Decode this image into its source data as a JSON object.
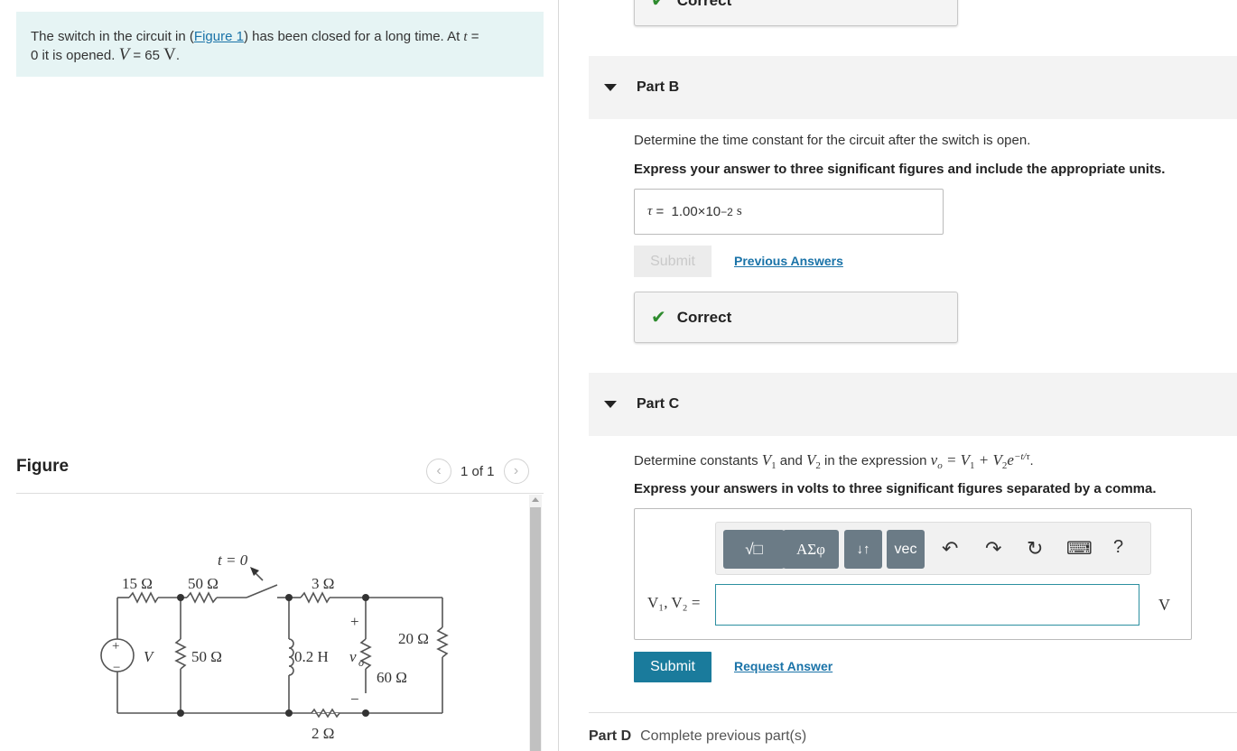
{
  "problem": {
    "text_before_link": "The switch in the circuit in (",
    "link": "Figure 1",
    "text_after_link": ") has been closed for a long time. At ",
    "t_var": "t",
    "eq_zero": " = ",
    "line2": "0 it is opened. ",
    "v_var": "V",
    "v_value": " = 65 ",
    "v_unit": "V",
    "period": "."
  },
  "figure": {
    "label": "Figure",
    "page": "1 of 1",
    "prev_icon": "chevron-left-icon",
    "next_icon": "chevron-right-icon",
    "circuit_labels": {
      "switch": "t = 0",
      "r15": "15 Ω",
      "r50a": "50 Ω",
      "r3": "3 Ω",
      "plus_top": "+",
      "r20": "20 Ω",
      "source": "V",
      "source_plus": "+",
      "source_minus": "−",
      "r50b": "50 Ω",
      "inductor": "0.2 H",
      "vo": "v",
      "vo_sub": "o",
      "r60": "60 Ω",
      "minus_bottom": "−",
      "r2": "2 Ω"
    }
  },
  "partA_feedback": {
    "label": "Correct"
  },
  "partB": {
    "title": "Part B",
    "question": "Determine the time constant for the circuit after the switch is open.",
    "instruction": "Express your answer to three significant figures and include the appropriate units.",
    "answer_var": "τ",
    "answer_eq": " = ",
    "answer_value": "1.00×10",
    "answer_exp": "−2",
    "answer_unit": "s",
    "submit_label": "Submit",
    "prev_answers_label": "Previous Answers",
    "feedback": "Correct"
  },
  "partC": {
    "title": "Part C",
    "question_prefix": "Determine constants ",
    "v1": "V",
    "v1_sub": "1",
    "and": " and ",
    "v2": "V",
    "v2_sub": "2",
    "question_mid": " in the expression ",
    "expression": "v",
    "expr_sub": "o",
    "expr_rest": " = V",
    "expr_1": "1",
    "expr_plus": " + V",
    "expr_2": "2",
    "expr_e": "e",
    "expr_exp": "−t/τ",
    "expr_end": ".",
    "instruction": "Express your answers in volts to three significant figures separated by a comma.",
    "toolbar": {
      "template_label": "√□",
      "greek_label": "ΑΣφ",
      "arrows_label": "↓↑",
      "vec_label": "vec",
      "undo_icon": "undo-icon",
      "redo_icon": "redo-icon",
      "reset_icon": "reset-icon",
      "keyboard_icon": "keyboard-icon",
      "help_label": "?"
    },
    "input_label": "V₁, V₂ =",
    "input_value": "",
    "unit": "V",
    "submit_label": "Submit",
    "request_label": "Request Answer"
  },
  "partD": {
    "title": "Part D",
    "status": "Complete previous part(s)"
  }
}
